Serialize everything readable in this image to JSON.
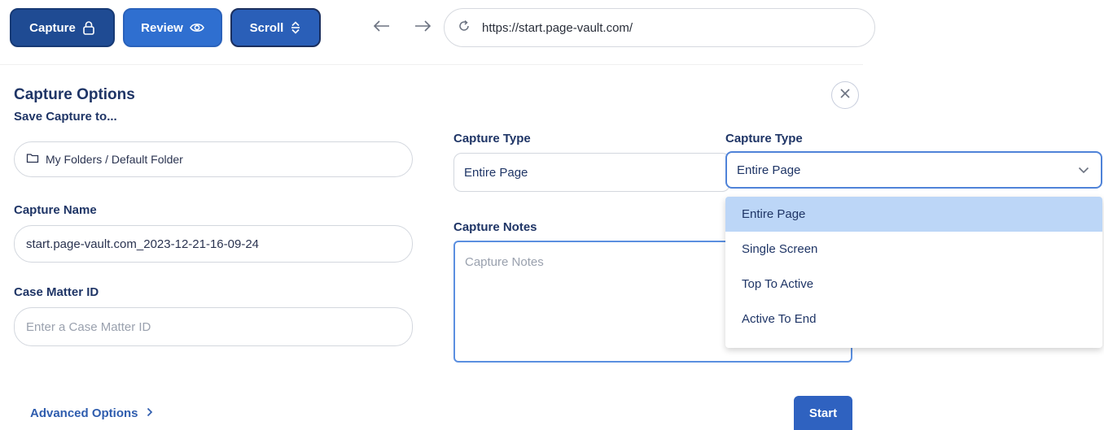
{
  "toolbar": {
    "capture_label": "Capture",
    "review_label": "Review",
    "scroll_label": "Scroll",
    "url": "https://start.page-vault.com/"
  },
  "panel": {
    "title": "Capture Options",
    "save_to_label": "Save Capture to...",
    "folder_path": "My Folders / Default Folder",
    "capture_name_label": "Capture Name",
    "capture_name_value": "start.page-vault.com_2023-12-21-16-09-24",
    "case_matter_label": "Case Matter ID",
    "case_matter_placeholder": "Enter a Case Matter ID",
    "capture_type_label": "Capture Type",
    "capture_type_value": "Entire Page",
    "capture_notes_label": "Capture Notes",
    "capture_notes_placeholder": "Capture Notes",
    "advanced_label": "Advanced Options",
    "start_label": "Start"
  },
  "dropdown": {
    "label": "Capture Type",
    "selected": "Entire Page",
    "options": [
      "Entire Page",
      "Single Screen",
      "Top To Active",
      "Active To End"
    ]
  },
  "icons": {
    "capture": "lock-icon",
    "review": "eye-icon",
    "scroll": "scroll-arrows-icon",
    "back": "arrow-left-icon",
    "forward": "arrow-right-icon",
    "reload": "reload-icon",
    "folder": "folder-icon",
    "close": "close-icon",
    "chevron_down": "chevron-down-icon",
    "chevron_right": "chevron-right-icon"
  },
  "colors": {
    "capture_button": "#1f4b93",
    "review_button": "#2f6fd0",
    "scroll_button": "#2a5fb8",
    "accent": "#2f62c0",
    "selected_option": "#bcd6f7",
    "heading": "#1f3566"
  }
}
